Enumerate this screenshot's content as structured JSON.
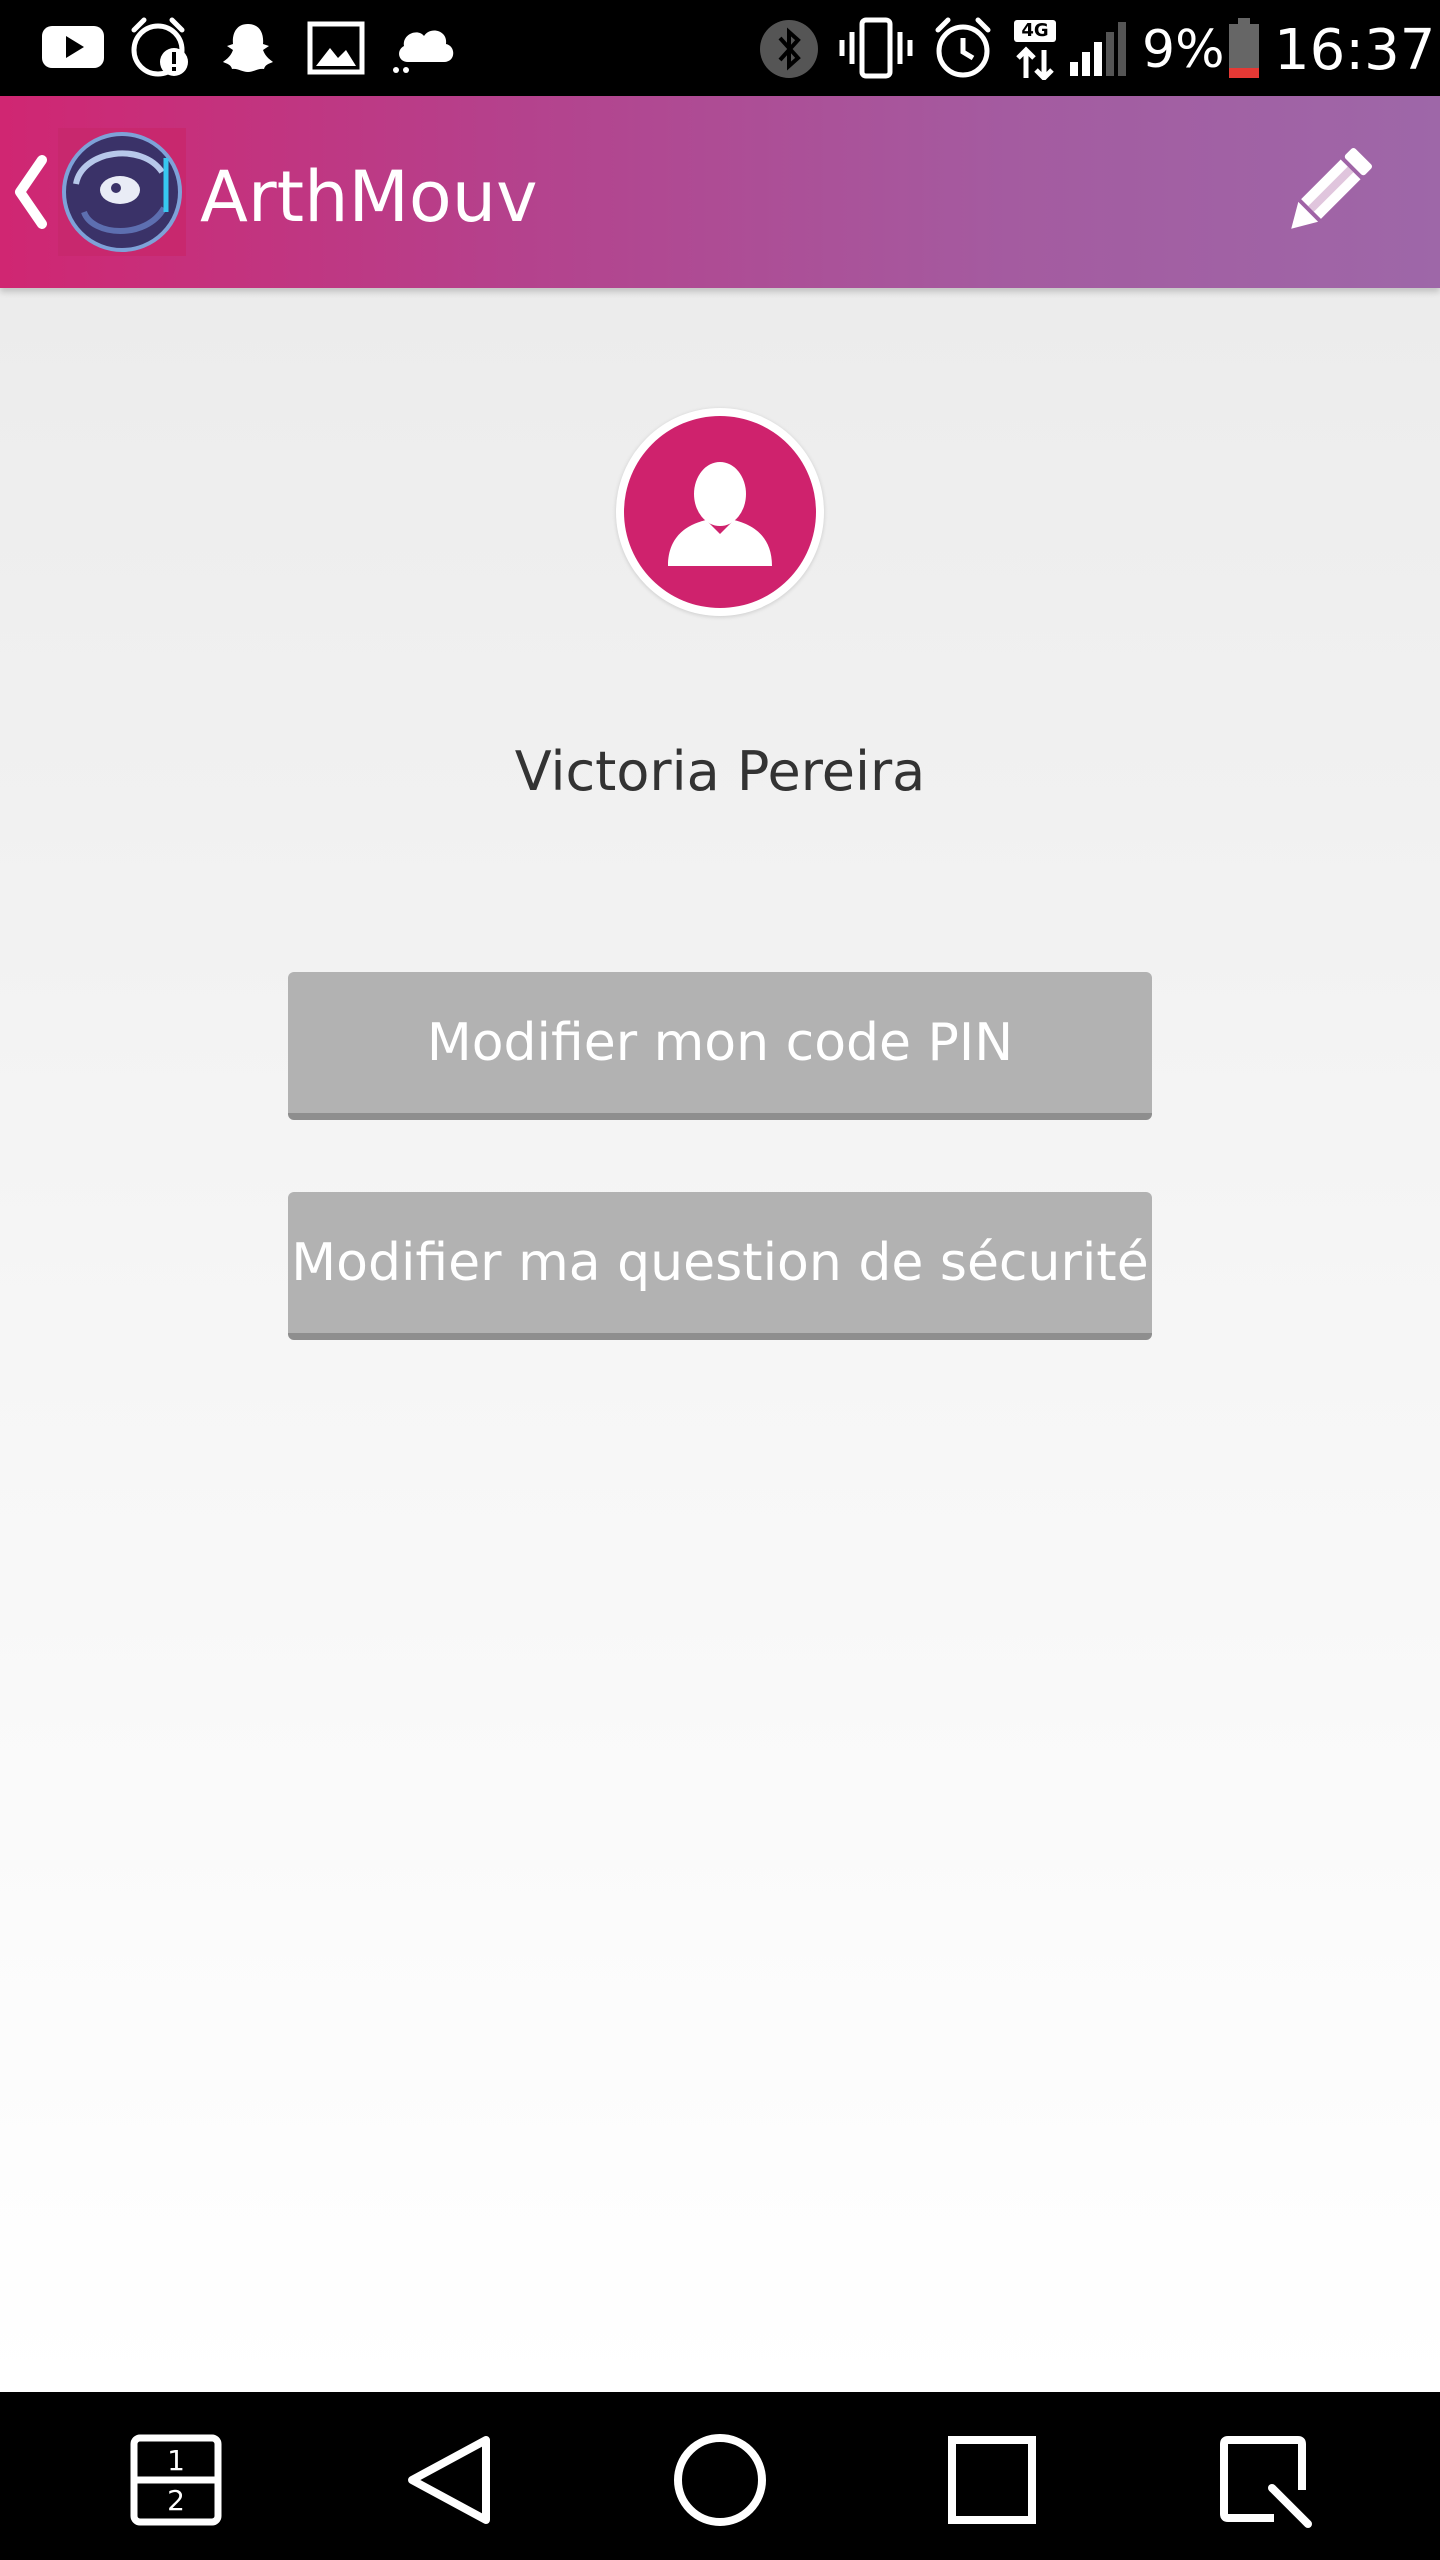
{
  "status_bar": {
    "battery": "9%",
    "time": "16:37",
    "network": "4G"
  },
  "app_bar": {
    "title": "ArthMouv"
  },
  "profile": {
    "name": "Victoria Pereira"
  },
  "actions": {
    "change_pin": "Modifier mon code PIN",
    "change_security_question": "Modifier ma question de sécurité"
  },
  "nav": {
    "multiwindow_top": "1",
    "multiwindow_bottom": "2"
  },
  "colors": {
    "accent": "#cf226d",
    "app_bar_start": "#d02672",
    "app_bar_end": "#9e67a8",
    "button_bg": "#b2b2b2",
    "battery_low": "#e53935"
  }
}
